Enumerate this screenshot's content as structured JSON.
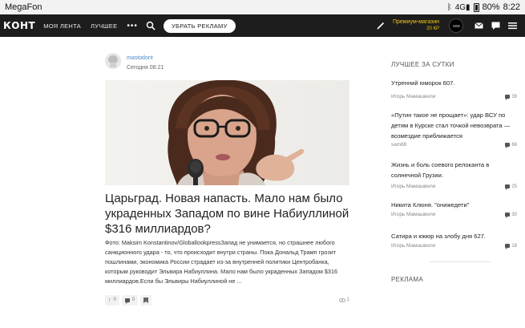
{
  "status_bar": {
    "carrier": "MegaFon",
    "signal": "4G",
    "battery": "80%",
    "time": "8:22"
  },
  "nav": {
    "logo": "КОНТ",
    "links": [
      "МОЯ ЛЕНТА",
      "ЛУЧШЕЕ"
    ],
    "more": "•••",
    "remove_ads": "УБРАТЬ РЕКЛАМУ",
    "premium_label": "Премиум-магазин",
    "premium_balance": "20 КР"
  },
  "post": {
    "author": "mastodont",
    "time": "Сегодня 08:21",
    "title": "Царьград. Новая напасть. Мало нам было украденных Западом по вине Набиуллиной $316 миллиардов?",
    "excerpt": "Фото: Maksim Konstantinov/GloballookpressЗапад не унимается, но страшнее любого санкционного удара - то, что происходит внутри страны. Пока Дональд Трамп грозит пошлинами, экономика России страдает из-за внутренней политики Центробанка, которым руководит Эльвира Набиуллина. Мало нам было украденных Западом $316 миллиардов.Если бы Эльвиры Набиуллиной не ...",
    "likes": "0",
    "comments": "0",
    "views": "1"
  },
  "sidebar": {
    "best_heading": "ЛУЧШЕЕ ЗА СУТКИ",
    "items": [
      {
        "title": "Утренний юморок 607.",
        "author": "Игорь Мамашвили",
        "comments": "39"
      },
      {
        "title": "«Путин такое не прощает»: удар ВСУ по детям в Курске стал точкой невозврата — возмездие приближается",
        "author": "sam88",
        "comments": "66"
      },
      {
        "title": "Жизнь и боль соевого релоканта в солнечной Грузии.",
        "author": "Игорь Мамашвили",
        "comments": "25"
      },
      {
        "title": "Никита Клюня. \"онижедети\"",
        "author": "Игорь Мамашвили",
        "comments": "30"
      },
      {
        "title": "Сатира и юмор на злобу дня 627.",
        "author": "Игорь Мамашвили",
        "comments": "18"
      }
    ],
    "ads_heading": "РЕКЛАМА"
  }
}
